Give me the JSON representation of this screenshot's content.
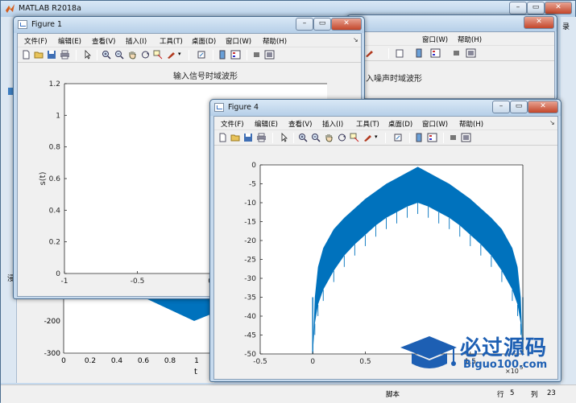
{
  "desktop": {
    "background_color": "#6d9ec7"
  },
  "matlab_window": {
    "title": "MATLAB R2018a",
    "right_text": "录",
    "status": {
      "script_label": "脚本",
      "row_label": "行",
      "row_value": "5",
      "col_label": "列",
      "col_value": "23"
    },
    "background_plot": {
      "y_ticks": [
        "-200",
        "-300"
      ],
      "x_ticks": [
        "0",
        "0.2",
        "0.4",
        "0.6",
        "0.8",
        "1"
      ],
      "xlabel": "t",
      "left_text": "浸"
    }
  },
  "hidden_figure": {
    "plot_title": "入噪声时域波形"
  },
  "menu_labels": [
    "文件(F)",
    "编辑(E)",
    "查看(V)",
    "插入(I)",
    "工具(T)",
    "桌面(D)",
    "窗口(W)",
    "帮助(H)"
  ],
  "figure1": {
    "title": "Figure 1",
    "chart_data": {
      "type": "line",
      "title": "输入信号时域波形",
      "xlabel": "t",
      "ylabel": "s(t)",
      "xlim": [
        -1,
        0.8
      ],
      "ylim": [
        0,
        1.2
      ],
      "x_ticks": [
        "-1",
        "-0.5",
        "0",
        "0.5"
      ],
      "y_ticks": [
        "0",
        "0.2",
        "0.4",
        "0.6",
        "0.8",
        "1",
        "1.2"
      ],
      "series": [
        {
          "x_start": 0,
          "x_end": 0.8,
          "upper": 0.95,
          "lower": 0,
          "pulse_count": 60
        }
      ],
      "line_color": "#0072bd"
    }
  },
  "figure4": {
    "title": "Figure 4",
    "chart_data": {
      "type": "line",
      "title": "",
      "xlabel": "",
      "ylabel": "",
      "xlim": [
        -0.5,
        2.0
      ],
      "ylim": [
        -50,
        0
      ],
      "x_ticks": [
        "-0.5",
        "0",
        "0.5",
        "1",
        "1.5"
      ],
      "y_ticks": [
        "0",
        "-5",
        "-10",
        "-15",
        "-20",
        "-25",
        "-30",
        "-35",
        "-40",
        "-45",
        "-50"
      ],
      "x_exponent_label": "×10",
      "x_exponent_power": "5",
      "series": [
        {
          "x": [
            0,
            0.02,
            0.05,
            0.1,
            0.2,
            0.3,
            0.4,
            0.5,
            0.6,
            0.7,
            0.8,
            0.9,
            1.0,
            1.1,
            1.2,
            1.3,
            1.4,
            1.5,
            1.6,
            1.7,
            1.8,
            1.9,
            1.95,
            1.98,
            2.0
          ],
          "upper": [
            -50,
            -35,
            -27,
            -22,
            -17,
            -14,
            -11.5,
            -9,
            -7,
            -5,
            -3.5,
            -2,
            -0.5,
            -2,
            -3.5,
            -5,
            -7,
            -9,
            -11.5,
            -14,
            -17,
            -22,
            -27,
            -35,
            -50
          ],
          "lower": [
            -50,
            -42,
            -37,
            -33,
            -28,
            -24,
            -21,
            -18.5,
            -16,
            -14,
            -12.5,
            -11,
            -10,
            -11,
            -12.5,
            -14,
            -16,
            -18.5,
            -21,
            -24,
            -28,
            -33,
            -37,
            -42,
            -50
          ]
        }
      ],
      "line_color": "#0072bd"
    }
  },
  "watermark": {
    "brand": "必过源码",
    "url": "Biguo100.com"
  }
}
